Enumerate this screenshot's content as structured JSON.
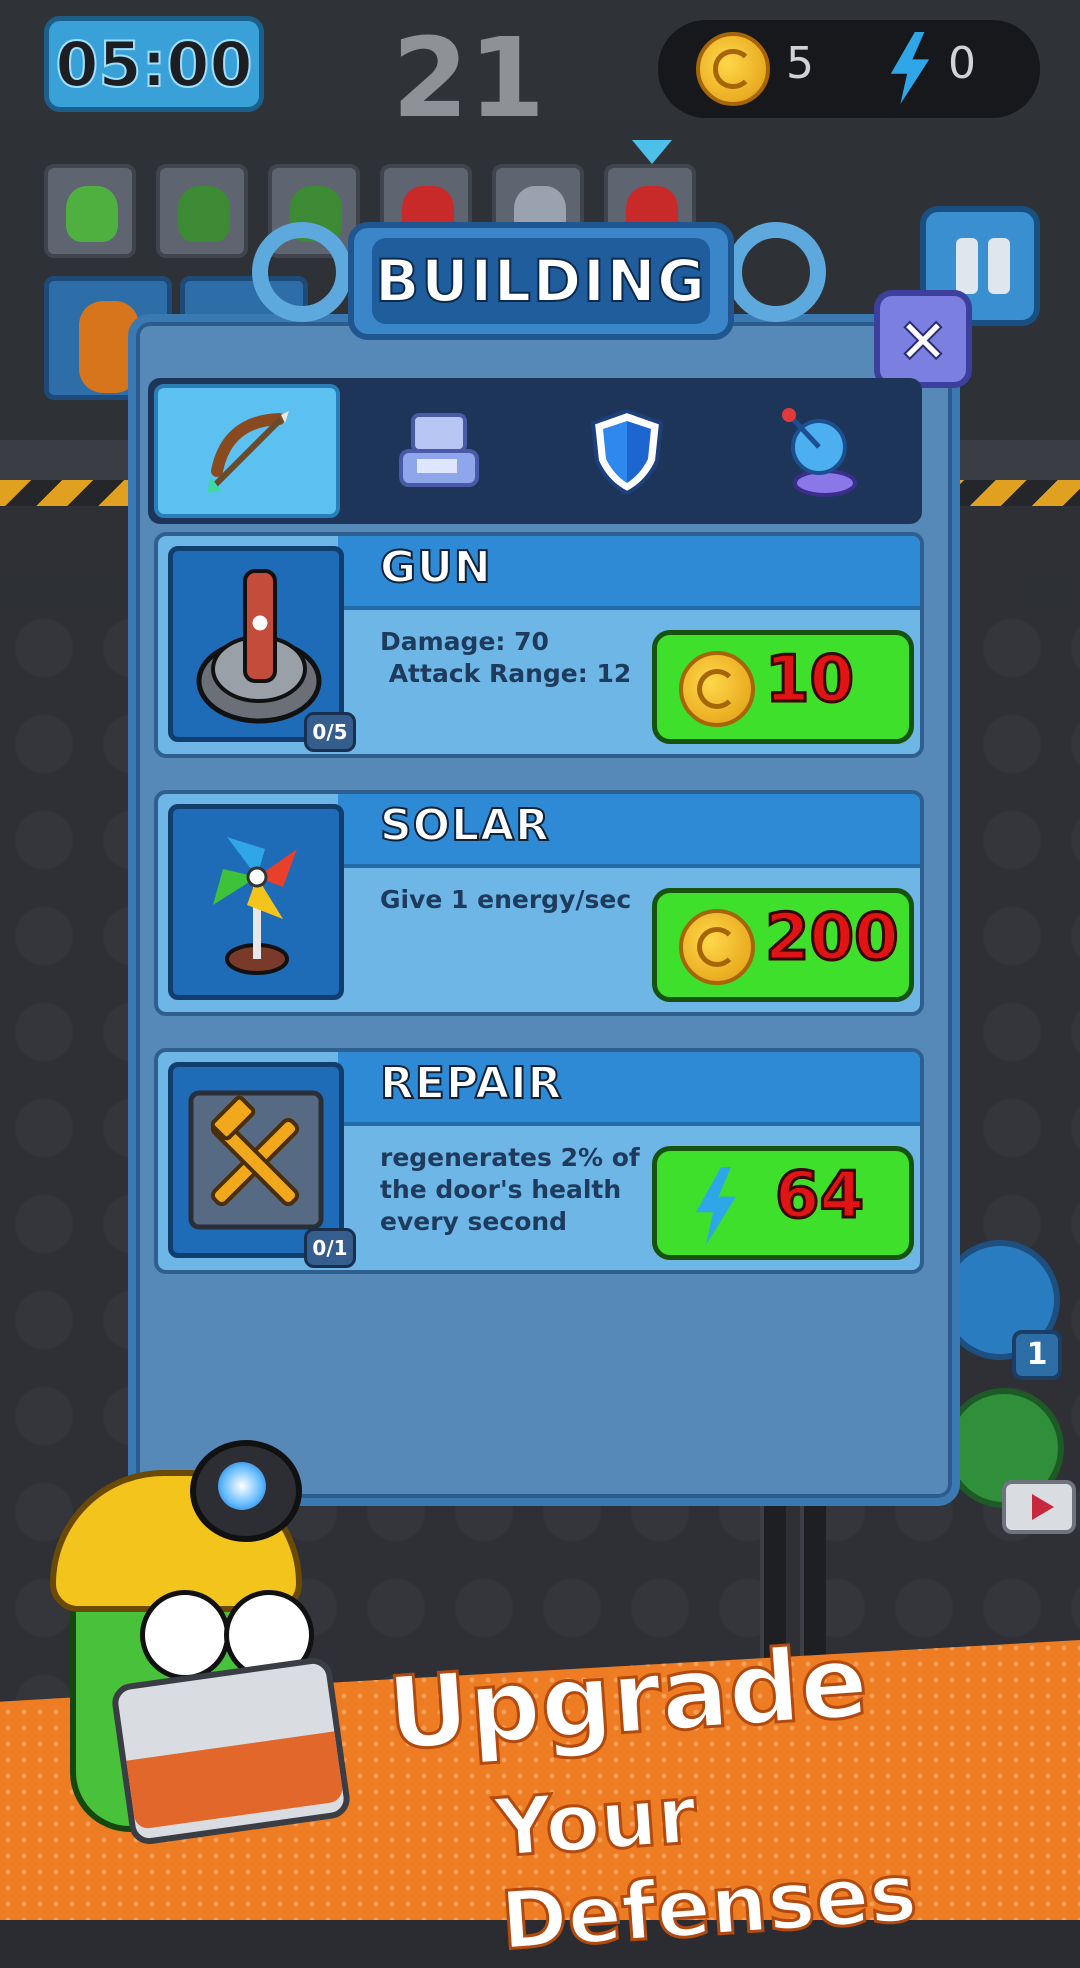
{
  "hud": {
    "timer": "05:00",
    "wave": "21",
    "coins": "5",
    "energy": "0",
    "coin_icon": "coin-icon",
    "energy_icon": "lightning-icon"
  },
  "queue": {
    "enemies": [
      "green-miner",
      "green-soldier",
      "green-soldier",
      "red-robot",
      "goggles-bot",
      "red-robot"
    ]
  },
  "modal": {
    "title": "BUILDING",
    "close_label": "×",
    "tabs": [
      {
        "name": "attack",
        "icon": "bow-arrow-icon",
        "active": true
      },
      {
        "name": "economy",
        "icon": "atm-icon",
        "active": false
      },
      {
        "name": "defense",
        "icon": "shield-icon",
        "active": false
      },
      {
        "name": "radar",
        "icon": "satellite-dish-icon",
        "active": false
      }
    ],
    "items": [
      {
        "name": "GUN",
        "desc_lines": [
          "Damage: 70",
          " Attack Range: 12"
        ],
        "count": "0/5",
        "price": "10",
        "currency": "coin",
        "icon": "turret-icon"
      },
      {
        "name": "SOLAR",
        "desc_lines": [
          "Give 1 energy/sec"
        ],
        "count": "",
        "price": "200",
        "currency": "coin",
        "icon": "pinwheel-icon"
      },
      {
        "name": "REPAIR",
        "desc_lines": [
          "regenerates 2% of",
          "the door's health",
          "every second"
        ],
        "count": "0/1",
        "price": "64",
        "currency": "energy",
        "icon": "tools-icon"
      }
    ]
  },
  "side": {
    "shield_count": "1"
  },
  "promo": {
    "line1": "Upgrade",
    "line2": "Your Defenses"
  },
  "colors": {
    "buy_green": "#3ee02c",
    "price_red": "#e01414",
    "panel_blue": "#5689b8",
    "promo_orange": "#ee7c22"
  }
}
